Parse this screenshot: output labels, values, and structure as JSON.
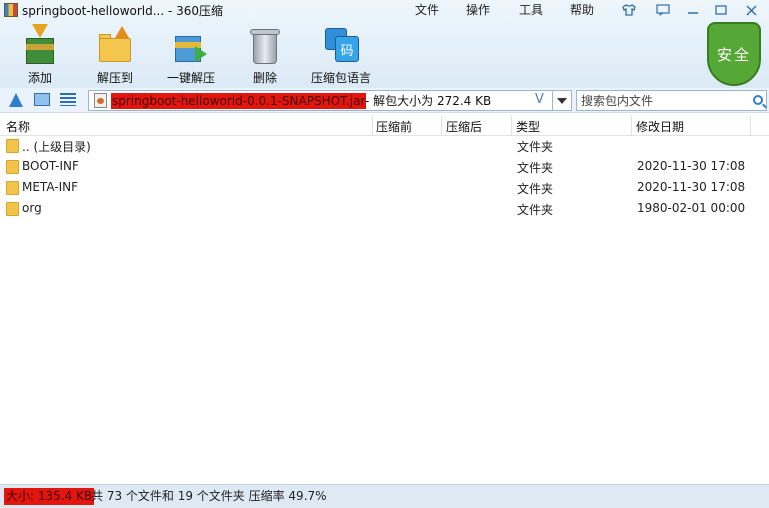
{
  "window": {
    "title": "springboot-helloworld... - 360压缩",
    "menu": [
      "文件",
      "操作",
      "工具",
      "帮助"
    ],
    "controls": [
      "shirt-icon",
      "message-icon",
      "minimize-icon",
      "restore-icon",
      "close-icon"
    ]
  },
  "toolbar": [
    {
      "label": "添加",
      "icon": "add-archive-icon"
    },
    {
      "label": "解压到",
      "icon": "extract-to-icon"
    },
    {
      "label": "一键解压",
      "icon": "one-click-extract-icon"
    },
    {
      "label": "删除",
      "icon": "delete-icon"
    },
    {
      "label": "压缩包语言",
      "icon": "archive-language-icon"
    }
  ],
  "security": {
    "label": "安全",
    "color": "#56a836"
  },
  "language_glyph": "码",
  "address": {
    "archive_name": "springboot-helloworld-0.0.1-SNAPSHOT.jar",
    "info": "- 解包大小为 272.4 KB",
    "v_mark": "V"
  },
  "search": {
    "placeholder": "搜索包内文件"
  },
  "columns": [
    "名称",
    "压缩前",
    "压缩后",
    "类型",
    "修改日期"
  ],
  "rows": [
    {
      "name": ".. (上级目录)",
      "type": "文件夹",
      "date": ""
    },
    {
      "name": "BOOT-INF",
      "type": "文件夹",
      "date": "2020-11-30 17:08"
    },
    {
      "name": "META-INF",
      "type": "文件夹",
      "date": "2020-11-30 17:08"
    },
    {
      "name": "org",
      "type": "文件夹",
      "date": "1980-02-01 00:00"
    }
  ],
  "status": {
    "size": "大小: 135.4 KB",
    "info": "共 73 个文件和 19 个文件夹 压缩率 49.7%"
  },
  "colors": {
    "highlight": "#e3160f",
    "accent": "#2f7fd0"
  }
}
